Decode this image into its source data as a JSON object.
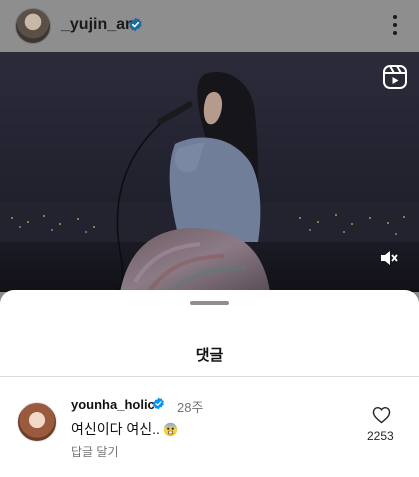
{
  "post": {
    "username": "_yujin_an",
    "avatar_icon": "profile-avatar",
    "verified_icon": "verified-badge-icon",
    "more_icon": "more-vertical-icon"
  },
  "video": {
    "reels_icon": "reels-icon",
    "mute_icon": "speaker-muted-icon"
  },
  "comments_sheet": {
    "title": "댓글",
    "comments": [
      {
        "username": "younha_holic",
        "time": "28주",
        "text": "여신이다 여신..",
        "emoji": "fearful-face-emoji",
        "reply_label": "답글 달기",
        "like_count": "2253"
      }
    ]
  },
  "colors": {
    "verified_blue": "#0095f6",
    "sheet_bg": "#ffffff",
    "muted_text": "#737373"
  }
}
